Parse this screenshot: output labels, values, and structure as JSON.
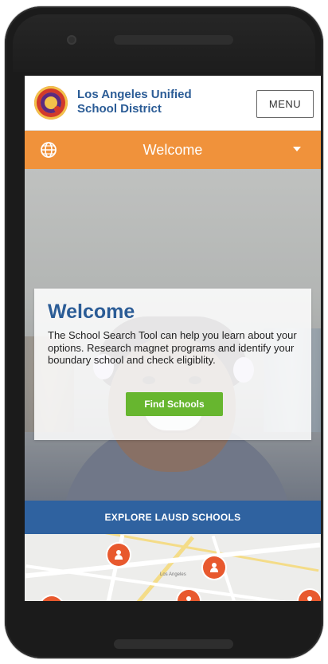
{
  "header": {
    "district_name": "Los Angeles Unified School District",
    "menu_label": "MENU"
  },
  "welcome_bar": {
    "title": "Welcome",
    "globe_icon": "globe-icon",
    "caret_icon": "chevron-down-icon"
  },
  "card": {
    "title": "Welcome",
    "body": "The School Search Tool can help you learn about your options. Research magnet programs and identify your boundary school and check eligiblity.",
    "button_label": "Find Schools"
  },
  "explore": {
    "label": "EXPLORE LAUSD SCHOOLS"
  },
  "map": {
    "city_label": "Los Angeles",
    "pin_icon": "school-pin-icon"
  },
  "colors": {
    "brand_blue": "#2b5c96",
    "welcome_orange": "#f0923b",
    "find_green": "#67b62f",
    "explore_blue": "#2f62a0",
    "pin_orange": "#e8592e"
  }
}
